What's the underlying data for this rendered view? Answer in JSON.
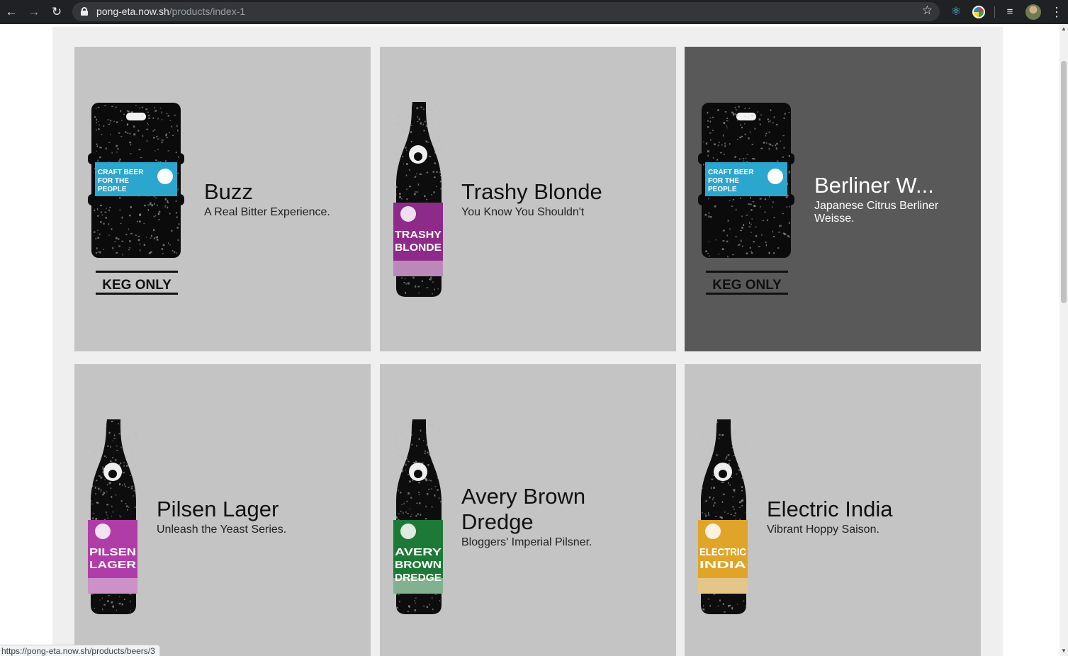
{
  "browser": {
    "url_host": "pong-eta.now.sh",
    "url_path": "/products/index-1",
    "status_url": "https://pong-eta.now.sh/products/beers/3"
  },
  "products": [
    {
      "name": "Buzz",
      "tagline": "A Real Bitter Experience.",
      "type": "keg",
      "label_color": "#2aa6cf",
      "keg_label": "KEG ONLY",
      "keg_text": "CRAFT BEER FOR THE PEOPLE",
      "active": false
    },
    {
      "name": "Trashy Blonde",
      "tagline": "You Know You Shouldn't",
      "type": "bottle",
      "label_color": "#8e2a8a",
      "label_text": "TRASHY BLONDE",
      "active": false
    },
    {
      "name": "Berliner W...",
      "tagline": "Japanese Citrus Berliner Weisse.",
      "type": "keg",
      "label_color": "#2aa6cf",
      "keg_label": "KEG ONLY",
      "keg_text": "CRAFT BEER FOR THE PEOPLE",
      "active": true
    },
    {
      "name": "Pilsen Lager",
      "tagline": "Unleash the Yeast Series.",
      "type": "bottle",
      "label_color": "#b03ca8",
      "label_text": "PILSEN LAGER",
      "active": false
    },
    {
      "name": "Avery Brown Dredge",
      "tagline": "Bloggers' Imperial Pilsner.",
      "type": "bottle",
      "label_color": "#1d7a36",
      "label_text": "AVERY BROWN DREDGE",
      "active": false
    },
    {
      "name": "Electric India",
      "tagline": "Vibrant Hoppy Saison.",
      "type": "bottle",
      "label_color": "#e0a528",
      "label_text": "ELECTRIC INDIA",
      "active": false
    }
  ]
}
